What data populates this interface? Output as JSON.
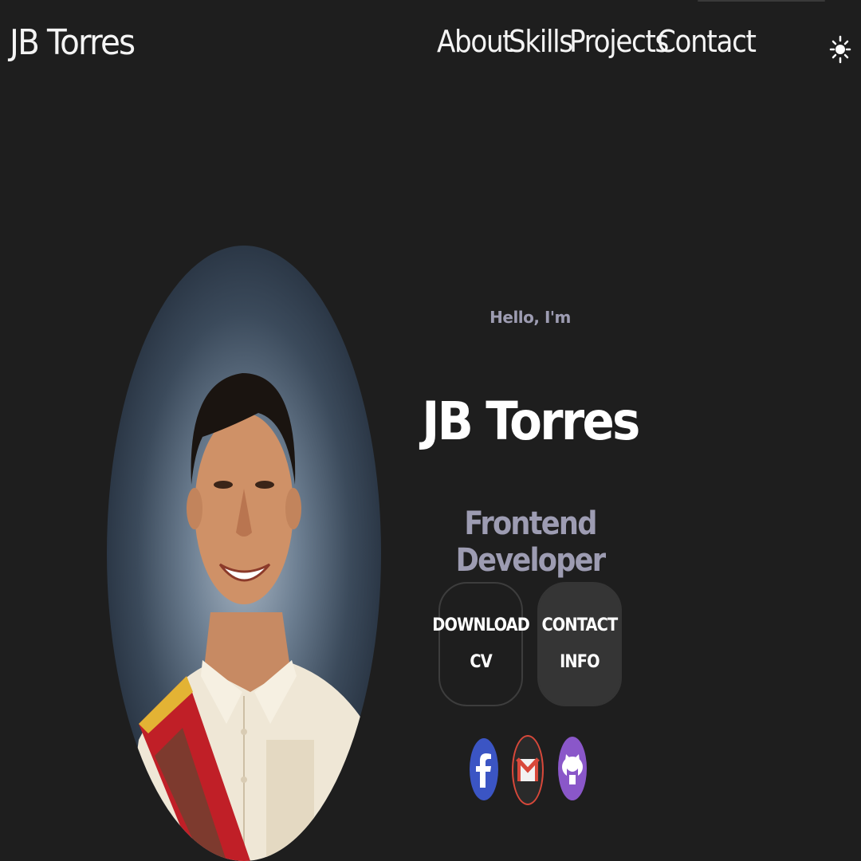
{
  "nav": {
    "brand": "JB Torres",
    "links": [
      {
        "label": "About"
      },
      {
        "label": "Skills"
      },
      {
        "label": "Projects"
      },
      {
        "label": "Contact"
      }
    ],
    "theme_toggle_icon": "sun-icon"
  },
  "hero": {
    "greeting": "Hello, I'm",
    "name": "JB Torres",
    "role": "Frontend Developer",
    "portrait_icon": "profile-photo",
    "buttons": {
      "download": {
        "line1": "DOWNLOAD",
        "line2": "CV"
      },
      "contact": {
        "line1": "CONTACT",
        "line2": "INFO"
      }
    },
    "socials": [
      {
        "icon": "facebook-icon",
        "color": "#3b55c4"
      },
      {
        "icon": "gmail-icon",
        "color": "#d8483a"
      },
      {
        "icon": "github-icon",
        "color": "#8a57c9"
      }
    ]
  },
  "colors": {
    "background": "#1e1e1e",
    "text": "#ffffff",
    "muted": "#9d9cb2",
    "button_fill": "#353535",
    "button_border": "#3d3d3d"
  }
}
